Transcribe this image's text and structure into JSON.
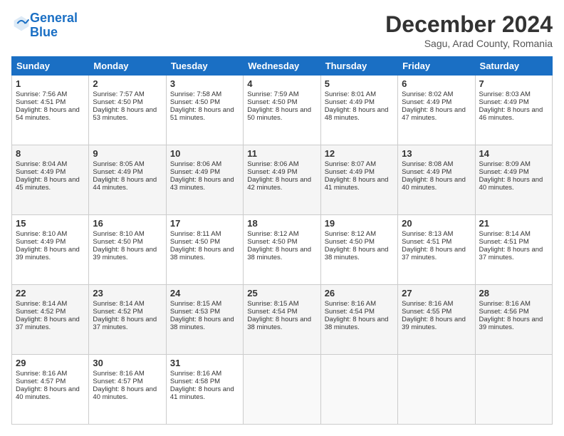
{
  "header": {
    "logo_line1": "General",
    "logo_line2": "Blue",
    "title": "December 2024",
    "subtitle": "Sagu, Arad County, Romania"
  },
  "weekdays": [
    "Sunday",
    "Monday",
    "Tuesday",
    "Wednesday",
    "Thursday",
    "Friday",
    "Saturday"
  ],
  "weeks": [
    [
      {
        "day": 1,
        "sunrise": "7:56 AM",
        "sunset": "4:51 PM",
        "daylight": "8 hours and 54 minutes."
      },
      {
        "day": 2,
        "sunrise": "7:57 AM",
        "sunset": "4:50 PM",
        "daylight": "8 hours and 53 minutes."
      },
      {
        "day": 3,
        "sunrise": "7:58 AM",
        "sunset": "4:50 PM",
        "daylight": "8 hours and 51 minutes."
      },
      {
        "day": 4,
        "sunrise": "7:59 AM",
        "sunset": "4:50 PM",
        "daylight": "8 hours and 50 minutes."
      },
      {
        "day": 5,
        "sunrise": "8:01 AM",
        "sunset": "4:49 PM",
        "daylight": "8 hours and 48 minutes."
      },
      {
        "day": 6,
        "sunrise": "8:02 AM",
        "sunset": "4:49 PM",
        "daylight": "8 hours and 47 minutes."
      },
      {
        "day": 7,
        "sunrise": "8:03 AM",
        "sunset": "4:49 PM",
        "daylight": "8 hours and 46 minutes."
      }
    ],
    [
      {
        "day": 8,
        "sunrise": "8:04 AM",
        "sunset": "4:49 PM",
        "daylight": "8 hours and 45 minutes."
      },
      {
        "day": 9,
        "sunrise": "8:05 AM",
        "sunset": "4:49 PM",
        "daylight": "8 hours and 44 minutes."
      },
      {
        "day": 10,
        "sunrise": "8:06 AM",
        "sunset": "4:49 PM",
        "daylight": "8 hours and 43 minutes."
      },
      {
        "day": 11,
        "sunrise": "8:06 AM",
        "sunset": "4:49 PM",
        "daylight": "8 hours and 42 minutes."
      },
      {
        "day": 12,
        "sunrise": "8:07 AM",
        "sunset": "4:49 PM",
        "daylight": "8 hours and 41 minutes."
      },
      {
        "day": 13,
        "sunrise": "8:08 AM",
        "sunset": "4:49 PM",
        "daylight": "8 hours and 40 minutes."
      },
      {
        "day": 14,
        "sunrise": "8:09 AM",
        "sunset": "4:49 PM",
        "daylight": "8 hours and 40 minutes."
      }
    ],
    [
      {
        "day": 15,
        "sunrise": "8:10 AM",
        "sunset": "4:49 PM",
        "daylight": "8 hours and 39 minutes."
      },
      {
        "day": 16,
        "sunrise": "8:10 AM",
        "sunset": "4:50 PM",
        "daylight": "8 hours and 39 minutes."
      },
      {
        "day": 17,
        "sunrise": "8:11 AM",
        "sunset": "4:50 PM",
        "daylight": "8 hours and 38 minutes."
      },
      {
        "day": 18,
        "sunrise": "8:12 AM",
        "sunset": "4:50 PM",
        "daylight": "8 hours and 38 minutes."
      },
      {
        "day": 19,
        "sunrise": "8:12 AM",
        "sunset": "4:50 PM",
        "daylight": "8 hours and 38 minutes."
      },
      {
        "day": 20,
        "sunrise": "8:13 AM",
        "sunset": "4:51 PM",
        "daylight": "8 hours and 37 minutes."
      },
      {
        "day": 21,
        "sunrise": "8:14 AM",
        "sunset": "4:51 PM",
        "daylight": "8 hours and 37 minutes."
      }
    ],
    [
      {
        "day": 22,
        "sunrise": "8:14 AM",
        "sunset": "4:52 PM",
        "daylight": "8 hours and 37 minutes."
      },
      {
        "day": 23,
        "sunrise": "8:14 AM",
        "sunset": "4:52 PM",
        "daylight": "8 hours and 37 minutes."
      },
      {
        "day": 24,
        "sunrise": "8:15 AM",
        "sunset": "4:53 PM",
        "daylight": "8 hours and 38 minutes."
      },
      {
        "day": 25,
        "sunrise": "8:15 AM",
        "sunset": "4:54 PM",
        "daylight": "8 hours and 38 minutes."
      },
      {
        "day": 26,
        "sunrise": "8:16 AM",
        "sunset": "4:54 PM",
        "daylight": "8 hours and 38 minutes."
      },
      {
        "day": 27,
        "sunrise": "8:16 AM",
        "sunset": "4:55 PM",
        "daylight": "8 hours and 39 minutes."
      },
      {
        "day": 28,
        "sunrise": "8:16 AM",
        "sunset": "4:56 PM",
        "daylight": "8 hours and 39 minutes."
      }
    ],
    [
      {
        "day": 29,
        "sunrise": "8:16 AM",
        "sunset": "4:57 PM",
        "daylight": "8 hours and 40 minutes."
      },
      {
        "day": 30,
        "sunrise": "8:16 AM",
        "sunset": "4:57 PM",
        "daylight": "8 hours and 40 minutes."
      },
      {
        "day": 31,
        "sunrise": "8:16 AM",
        "sunset": "4:58 PM",
        "daylight": "8 hours and 41 minutes."
      },
      null,
      null,
      null,
      null
    ]
  ]
}
